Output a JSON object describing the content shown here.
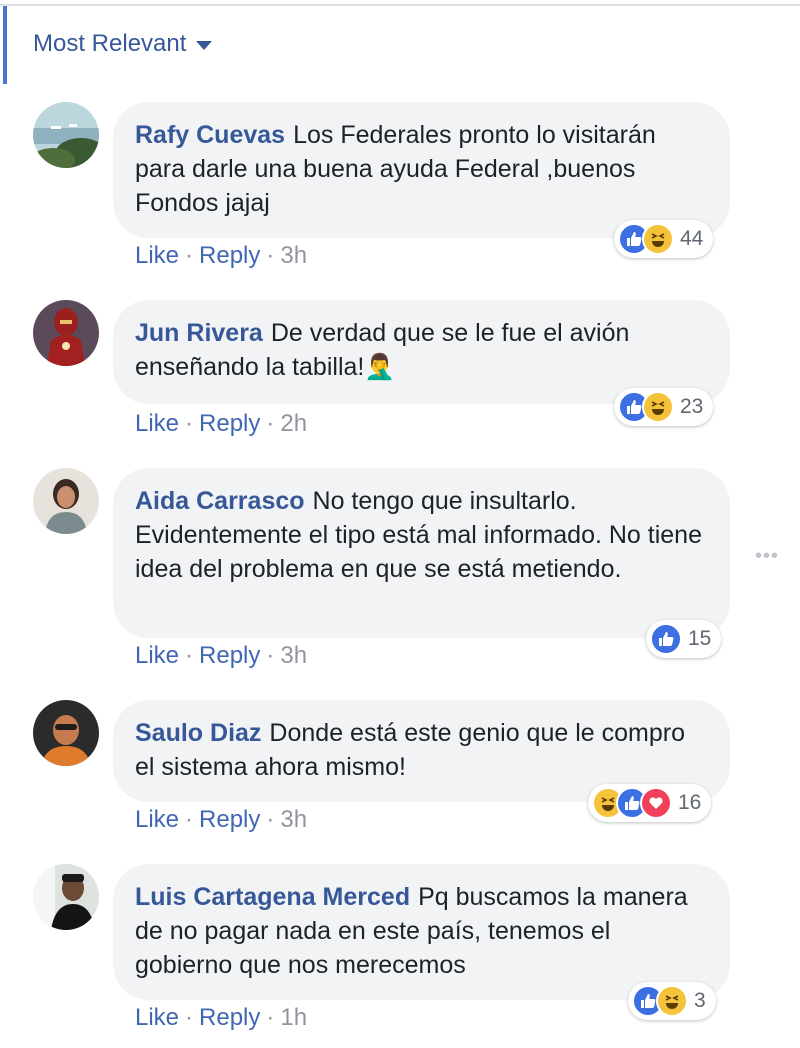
{
  "sort": {
    "label": "Most Relevant"
  },
  "more_label": "•••",
  "action_labels": {
    "like": "Like",
    "reply": "Reply",
    "sep": "·"
  },
  "colors": {
    "link": "#365899",
    "bubble": "#f2f3f5",
    "like": "#3b6fe2",
    "haha": "#f5c33b",
    "love": "#f0405a"
  },
  "comments": [
    {
      "author": "Rafy Cuevas",
      "text": "Los Federales pronto lo visitarán para darle una buena ayuda Federal ,buenos Fondos jajaj",
      "time": "3h",
      "reactions": [
        "like",
        "haha"
      ],
      "reaction_count": "44"
    },
    {
      "author": "Jun Rivera",
      "text": "De verdad que se le fue el avión enseñando la tabilla!🤦‍♂️",
      "time": "2h",
      "reactions": [
        "like",
        "haha"
      ],
      "reaction_count": "23"
    },
    {
      "author": "Aida Carrasco",
      "text": "No tengo que insultarlo. Evidentemente el tipo está mal informado. No tiene idea del problema en que se está metiendo.",
      "time": "3h",
      "reactions": [
        "like"
      ],
      "reaction_count": "15"
    },
    {
      "author": "Saulo Diaz",
      "text": "Donde está este genio que le compro el sistema ahora mismo!",
      "time": "3h",
      "reactions": [
        "haha",
        "like",
        "love"
      ],
      "reaction_count": "16"
    },
    {
      "author": "Luis Cartagena Merced",
      "text": "Pq buscamos la manera de no pagar nada en este país, tenemos el gobierno que nos merecemos",
      "time": "1h",
      "reactions": [
        "like",
        "haha"
      ],
      "reaction_count": "3"
    }
  ]
}
